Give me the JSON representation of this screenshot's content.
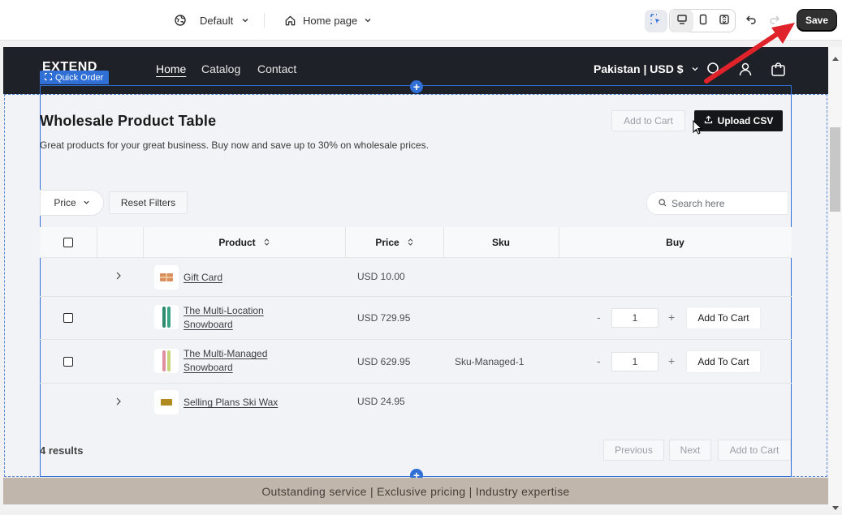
{
  "editor": {
    "theme_selector": "Default",
    "page_selector": "Home page",
    "save_label": "Save"
  },
  "store": {
    "logo": "EXTEND",
    "nav": [
      "Home",
      "Catalog",
      "Contact"
    ],
    "locale": "Pakistan | USD $"
  },
  "block_tag": "Quick Order",
  "section": {
    "title": "Wholesale Product Table",
    "subtitle": "Great products for your great business. Buy now and save up to 30% on wholesale prices.",
    "add_to_cart_top": "Add to Cart",
    "upload_csv": "Upload CSV",
    "filter_price": "Price",
    "reset_filters": "Reset Filters",
    "search_placeholder": "Search here"
  },
  "table": {
    "headers": {
      "product": "Product",
      "price": "Price",
      "sku": "Sku",
      "buy": "Buy"
    },
    "rows": [
      {
        "name": "Gift Card",
        "price": "USD 10.00",
        "sku": "",
        "expandable": true,
        "qty": "",
        "add": ""
      },
      {
        "name_line1": "The Multi-Location",
        "name_line2": "Snowboard",
        "price": "USD 729.95",
        "sku": "",
        "qty": "1",
        "add": "Add To Cart"
      },
      {
        "name_line1": "The Multi-Managed",
        "name_line2": "Snowboard",
        "price": "USD 629.95",
        "sku": "Sku-Managed-1",
        "qty": "1",
        "add": "Add To Cart"
      },
      {
        "name": "Selling Plans Ski Wax",
        "price": "USD 24.95",
        "sku": "",
        "expandable": true,
        "qty": "",
        "add": ""
      }
    ]
  },
  "footer": {
    "results": "4 results",
    "previous": "Previous",
    "next": "Next",
    "add_to_cart": "Add to Cart"
  },
  "announcement": "Outstanding service | Exclusive pricing | Industry expertise",
  "colors": {
    "accent": "#2f6fd6",
    "annotation": "#e0222a",
    "announce_bg": "#c1b6ab",
    "header_bg": "#1e2127"
  }
}
